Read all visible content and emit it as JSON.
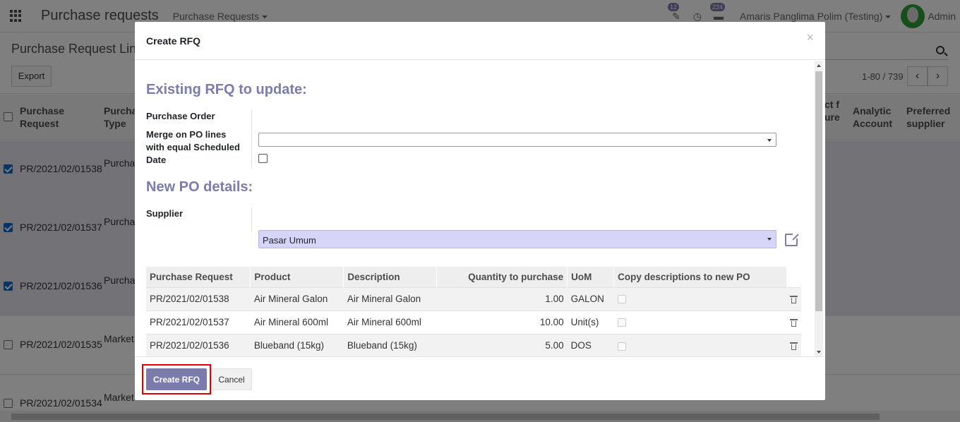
{
  "app": {
    "title": "Purchase requests",
    "menu": "Purchase Requests",
    "activity_count": "12",
    "message_count": "224",
    "company": "Amaris Panglima Polim (Testing)",
    "user": "Admin"
  },
  "control_panel": {
    "title": "Purchase Request Lin",
    "export_label": "Export",
    "pager": "1-80 / 739",
    "prev": "‹",
    "next": "›"
  },
  "list": {
    "headers": {
      "purchase_request": "Purchase Request",
      "purchase_type": "Purcha Type",
      "product_procure": "ct f ure",
      "analytic_account": "Analytic Account",
      "preferred_supplier": "Preferred supplier"
    },
    "rows": [
      {
        "pr": "PR/2021/02/01538",
        "type": "Purchase Request",
        "selected": true
      },
      {
        "pr": "PR/2021/02/01537",
        "type": "Purchase Request",
        "selected": true
      },
      {
        "pr": "PR/2021/02/01536",
        "type": "Purchase Request",
        "selected": true
      },
      {
        "pr": "PR/2021/02/01535",
        "type": "Market List",
        "selected": false
      },
      {
        "pr": "PR/2021/02/01534",
        "type": "Market",
        "selected": false
      }
    ]
  },
  "modal": {
    "title": "Create RFQ",
    "close": "×",
    "existing_section": "Existing RFQ to update:",
    "purchase_order_label": "Purchase Order",
    "purchase_order_value": "",
    "merge_label": "Merge on PO lines with equal Scheduled Date",
    "merge_checked": false,
    "new_section": "New PO details:",
    "supplier_label": "Supplier",
    "supplier_value": "Pasar Umum",
    "table": {
      "headers": [
        "Purchase Request",
        "Product",
        "Description",
        "Quantity to purchase",
        "UoM",
        "Copy descriptions to new PO"
      ],
      "rows": [
        {
          "pr": "PR/2021/02/01538",
          "product": "Air Mineral Galon",
          "description": "Air Mineral Galon",
          "qty": "1.00",
          "uom": "GALON",
          "copy": false
        },
        {
          "pr": "PR/2021/02/01537",
          "product": "Air Mineral 600ml",
          "description": "Air Mineral 600ml",
          "qty": "10.00",
          "uom": "Unit(s)",
          "copy": false
        },
        {
          "pr": "PR/2021/02/01536",
          "product": "Blueband (15kg)",
          "description": "Blueband (15kg)",
          "qty": "5.00",
          "uom": "DOS",
          "copy": false
        }
      ]
    },
    "create_button": "Create RFQ",
    "cancel_button": "Cancel"
  },
  "colors": {
    "accent": "#7c7bad",
    "highlight": "#e00000",
    "supplier_bg": "#d6d5f7"
  }
}
